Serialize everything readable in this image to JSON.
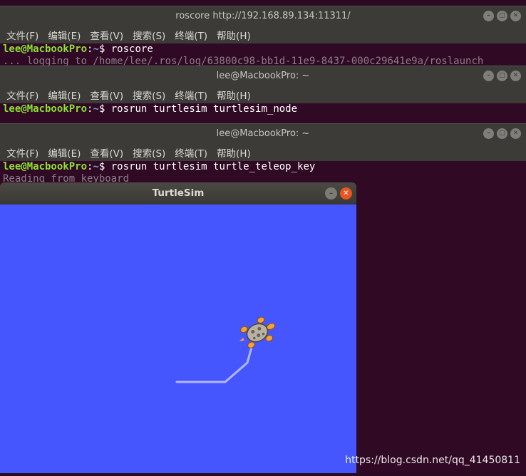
{
  "menu": [
    "文件(F)",
    "编辑(E)",
    "查看(V)",
    "搜索(S)",
    "终端(T)",
    "帮助(H)"
  ],
  "window_buttons": {
    "minimize": "–",
    "maximize": "▢",
    "close": "✕"
  },
  "prompt": {
    "user": "lee@MacbookPro",
    "sep": ":",
    "path": "~",
    "dollar": "$ "
  },
  "terminals": [
    {
      "title": "roscore http://192.168.89.134:11311/",
      "command": "roscore",
      "partial": "... logging to /home/lee/.ros/log/63800c98-bb1d-11e9-8437-000c29641e9a/roslaunch"
    },
    {
      "title": "lee@MacbookPro: ~",
      "command": "rosrun turtlesim turtlesim_node",
      "partial": ""
    },
    {
      "title": "lee@MacbookPro: ~",
      "command": "rosrun turtlesim turtle_teleop_key",
      "partial": "Reading from keyboard"
    }
  ],
  "turtlesim": {
    "title": "TurtleSim",
    "background_color": "#4556ff",
    "trail_color": "#b3b8ff"
  },
  "watermark": "https://blog.csdn.net/qq_41450811"
}
